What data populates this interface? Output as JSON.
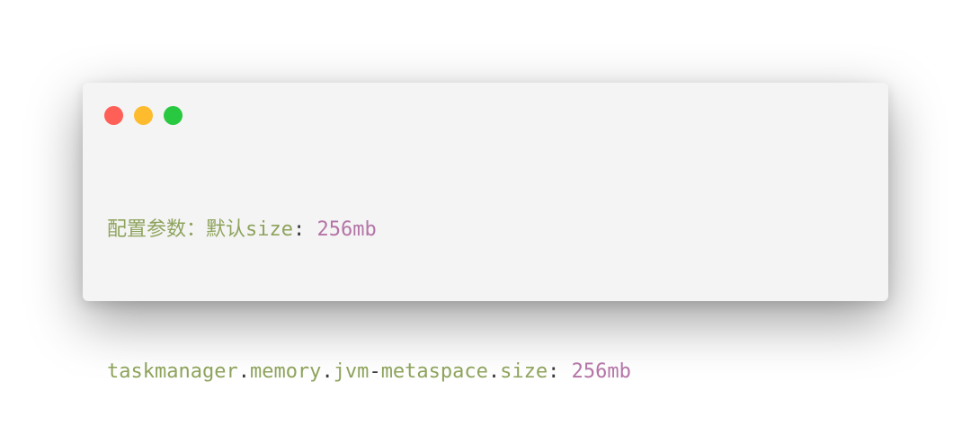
{
  "window_controls": {
    "close_color": "#fe5f57",
    "minimize_color": "#febb2e",
    "maximize_color": "#28c840"
  },
  "code": {
    "line1": {
      "comment": "配置参数：默认size",
      "colon": ":",
      "value": "256mb"
    },
    "line2": {
      "key_part1": "taskmanager",
      "dot1": ".",
      "key_part2": "memory",
      "dot2": ".",
      "key_part3": "jvm",
      "dash": "-",
      "key_part4": "metaspace",
      "dot3": ".",
      "key_part5": "size",
      "colon": ":",
      "value": "256mb"
    }
  },
  "colors": {
    "key": "#8ea35c",
    "punctuation": "#3a3a3a",
    "value": "#b474a7",
    "background": "#f4f4f4"
  }
}
